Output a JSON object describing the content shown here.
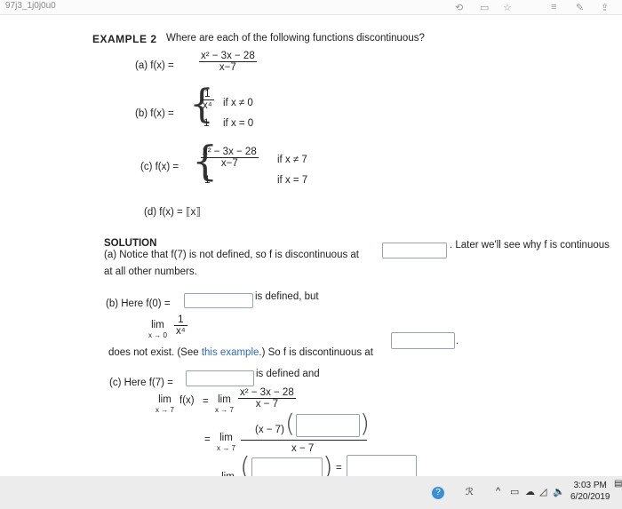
{
  "topbar": {
    "url_fragment": "97j3_1j0j0u0"
  },
  "example": {
    "title": "EXAMPLE 2",
    "question": "Where are each of the following functions discontinuous?",
    "a": {
      "label": "(a)  f(x) =",
      "num": "x² − 3x − 28",
      "den": "x−7"
    },
    "b": {
      "label": "(b)  f(x) =",
      "case1_num": "1",
      "case1_den": "x⁴",
      "case1_cond": "if x ≠ 0",
      "case2_val": "1",
      "case2_cond": "if x = 0"
    },
    "c": {
      "label": "(c)  f(x) =",
      "case1_num": "x² − 3x − 28",
      "case1_den": "x−7",
      "case1_cond": "if x ≠ 7",
      "case2_val": "1",
      "case2_cond": "if x = 7"
    },
    "d": {
      "label": "(d)  f(x) = ⟦x⟧"
    }
  },
  "solution": {
    "heading": "SOLUTION",
    "a_line1": "(a) Notice that f(7) is not defined, so f is discontinuous at",
    "a_after": ". Later we'll see why f is continuous",
    "a_line2": "at all other numbers.",
    "b_line1": "(b) Here f(0) =",
    "b_after": "is defined, but",
    "b_lim": "lim",
    "b_lim_sub": "x → 0",
    "b_frac_num": "1",
    "b_frac_den": "x⁴",
    "b_line3_pre": "does not exist. (See ",
    "b_link": "this example",
    "b_line3_post": ".) So f is discontinuous at",
    "b_end": ".",
    "c_line1": "(c) Here f(7) =",
    "c_after": "is defined and",
    "c_lim": "lim",
    "c_lim_sub": "x → 7",
    "c_fx": "f(x)",
    "c_eq": "=",
    "c_frac_num": "x² − 3x − 28",
    "c_frac_den": "x − 7",
    "c_num2": "(x − 7)",
    "c_den2": "x − 7",
    "c_eq3_right": "="
  },
  "taskbar": {
    "time": "3:03 PM",
    "date": "6/20/2019"
  }
}
